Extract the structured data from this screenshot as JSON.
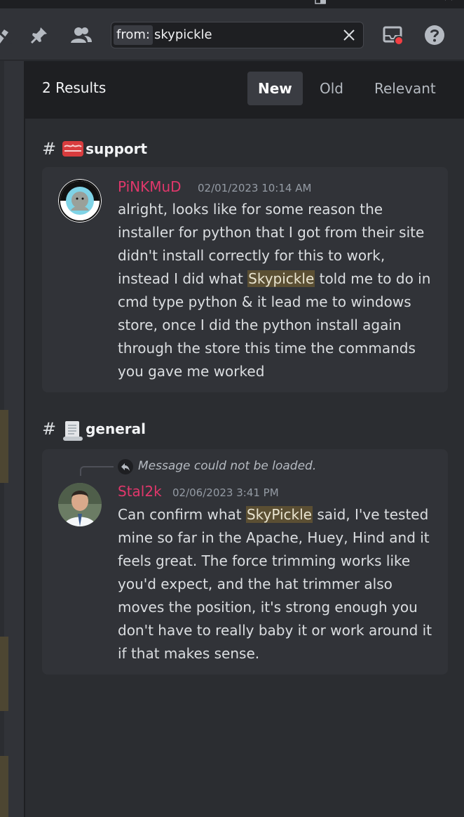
{
  "header": {
    "search_filter": "from:",
    "search_query": "skypickle"
  },
  "results": {
    "count_label": "2 Results",
    "sort_tabs": [
      {
        "label": "New",
        "active": true
      },
      {
        "label": "Old",
        "active": false
      },
      {
        "label": "Relevant",
        "active": false
      }
    ]
  },
  "groups": [
    {
      "channel_hash": "#",
      "channel_name": "support",
      "channel_emoji": "support-banner-icon",
      "message": {
        "author": "PiNKMuD",
        "timestamp": "02/01/2023 10:14 AM",
        "text_before": "alright, looks like for some reason the installer for python that I got from their site didn't install correctly for this to work, instead I did what ",
        "mention": "Skypickle",
        "text_after": " told me to do in cmd type python & it lead me to windows store, once I did the python install again through the store this time the commands you gave me worked"
      }
    },
    {
      "channel_hash": "#",
      "channel_name": "general",
      "channel_emoji": "scroll-icon",
      "reply_notice": "Message could not be loaded.",
      "message": {
        "author": "Stal2k",
        "timestamp": "02/06/2023 3:41 PM",
        "text_before": "Can confirm what ",
        "mention": "SkyPickle",
        "text_after": " said, I've tested mine so far in the Apache, Huey, Hind and it feels great. The force trimming works like you'd expect, and the hat trimmer also moves the position, it's strong enough you don't have to really baby it or work around it if that makes sense."
      }
    }
  ],
  "colors": {
    "author": "#e0376b",
    "mention_bg": "#5b4f33",
    "panel_bg": "#2b2d31",
    "card_bg": "#313338"
  }
}
